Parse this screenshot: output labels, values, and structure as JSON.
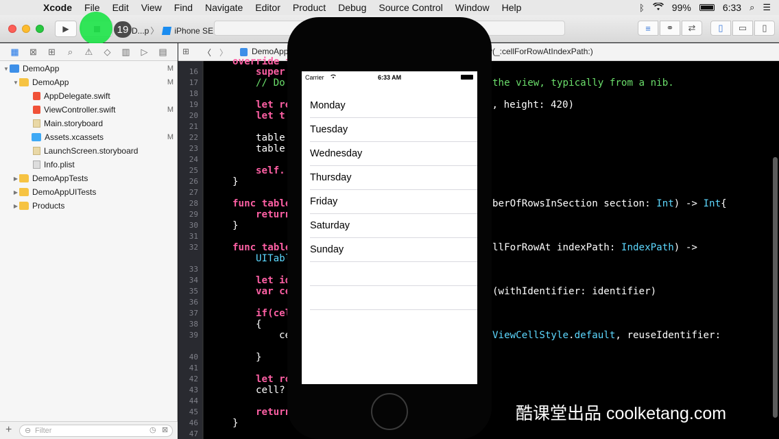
{
  "menubar": {
    "apple": "",
    "items": [
      "Xcode",
      "File",
      "Edit",
      "View",
      "Find",
      "Navigate",
      "Editor",
      "Product",
      "Debug",
      "Source Control",
      "Window",
      "Help"
    ],
    "battery": "99%",
    "time": "6:33"
  },
  "toolbar": {
    "badge": "19",
    "scheme": "D...p",
    "device": "iPhone SE"
  },
  "navigator": {
    "filter_placeholder": "Filter",
    "tree": [
      {
        "label": "DemoApp",
        "icon": "project-icon",
        "expanded": true,
        "flag": "M"
      },
      {
        "label": "DemoApp",
        "icon": "folder-icon",
        "expanded": true,
        "flag": "M"
      },
      {
        "label": "AppDelegate.swift",
        "icon": "swift-file-icon",
        "flag": ""
      },
      {
        "label": "ViewController.swift",
        "icon": "swift-file-icon",
        "flag": "M"
      },
      {
        "label": "Main.storyboard",
        "icon": "storyboard-icon",
        "flag": ""
      },
      {
        "label": "Assets.xcassets",
        "icon": "assets-icon",
        "flag": "M"
      },
      {
        "label": "LaunchScreen.storyboard",
        "icon": "storyboard-icon",
        "flag": ""
      },
      {
        "label": "Info.plist",
        "icon": "plist-icon",
        "flag": ""
      },
      {
        "label": "DemoAppTests",
        "icon": "folder-icon",
        "expanded": false,
        "flag": ""
      },
      {
        "label": "DemoAppUITests",
        "icon": "folder-icon",
        "expanded": false,
        "flag": ""
      },
      {
        "label": "Products",
        "icon": "folder-icon",
        "expanded": false,
        "flag": ""
      }
    ]
  },
  "jumpbar": {
    "project": "DemoApp",
    "method": "v(_:cellForRowAtIndexPath:)"
  },
  "editor": {
    "line_numbers": [
      "16",
      "17",
      "18",
      "19",
      "20",
      "21",
      "22",
      "23",
      "24",
      "25",
      "26",
      "27",
      "28",
      "29",
      "30",
      "31",
      "32",
      "33",
      "34",
      "35",
      "36",
      "37",
      "38",
      "39",
      "40",
      "41",
      "42",
      "43",
      "44",
      "45",
      "46",
      "47"
    ],
    "lines": {
      "l15": "override f",
      "l16": "super",
      "l17a": "// Do",
      "l17b": "the view, typically from a nib.",
      "l19a": "let re",
      "l19b": ", height: 420)",
      "l19c": "0",
      "l20": "let t",
      "l22": "table.",
      "l23": "table",
      "l25": "self.",
      "l26": "}",
      "l28a": "func table",
      "l28b": "berOfRowsInSection section: ",
      "l28c": "Int",
      "l28d": ") -> ",
      "l28e": "Int",
      "l28f": "{",
      "l29": "return",
      "l30": "}",
      "l32a": "func table",
      "l32b": "llForRowAt indexPath: ",
      "l32c": "IndexPath",
      "l32d": ") ->",
      "l32e": "UITabl",
      "l34": "let id",
      "l35a": "var ce",
      "l35b": "(withIdentifier: identifier)",
      "l37": "if(cel",
      "l38": "{",
      "l39a": "ce",
      "l39b": "ViewCellStyle",
      "l39c": ".",
      "l39d": "default",
      "l39e": ", reuseIdentifier:",
      "l40": "}",
      "l42": "let ro",
      "l43": "cell?.",
      "l45": "return",
      "l46": "}"
    }
  },
  "simulator": {
    "carrier": "Carrier",
    "time": "6:33 AM",
    "rows": [
      "Monday",
      "Tuesday",
      "Wednesday",
      "Thursday",
      "Friday",
      "Saturday",
      "Sunday",
      "",
      ""
    ]
  },
  "watermark": "酷课堂出品 coolketang.com"
}
